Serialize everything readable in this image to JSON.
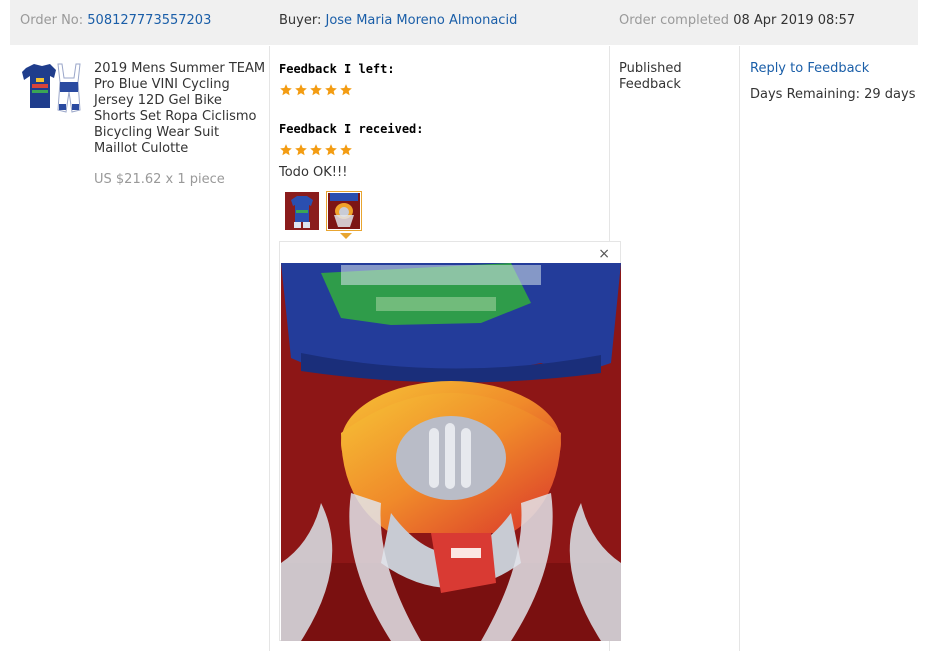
{
  "order": {
    "order_no_label": "Order No:",
    "order_no": "508127773557203",
    "buyer_label": "Buyer:",
    "buyer_name": "Jose Maria Moreno Almonacid",
    "completed_label": "Order completed",
    "completed_date": "08 Apr 2019 08:57"
  },
  "product": {
    "title": "2019 Mens Summer TEAM Pro Blue VINI Cycling Jersey 12D Gel Bike Shorts Set Ropa Ciclismo Bicycling Wear Suit Maillot Culotte",
    "price": "US $21.62 x 1 piece"
  },
  "feedback": {
    "left_label": "Feedback I left:",
    "left_rating": 5,
    "received_label": "Feedback I received:",
    "received_rating": 5,
    "comment": "Todo OK!!!",
    "close_symbol": "×"
  },
  "status": {
    "text": "Published Feedback"
  },
  "actions": {
    "reply_label": "Reply to Feedback",
    "days_remaining": "Days Remaining: 29 days"
  },
  "colors": {
    "link": "#1a5ea8",
    "star": "#f39c12",
    "header_bg": "#f0f0f0",
    "active_thumb_border": "#e8a530"
  },
  "icons": {
    "star": "star-icon",
    "close": "close-icon"
  }
}
